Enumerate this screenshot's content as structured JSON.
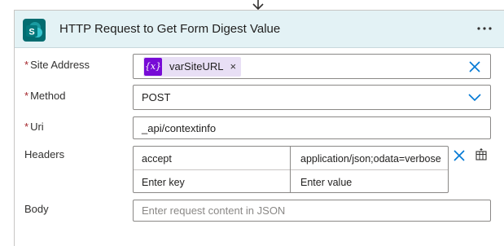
{
  "action": {
    "title": "HTTP Request to Get Form Digest Value",
    "more_icon": "more-options-icon",
    "connector_icon": "sharepoint-icon",
    "connector_color": "#036c70",
    "header_color": "#e3f2f5"
  },
  "fields": {
    "site_address": {
      "label": "Site Address",
      "required_mark": "*",
      "token_label": "varSiteURL",
      "token_icon_text": "{x}",
      "token_remove": "×",
      "token_color": "#770bd6"
    },
    "method": {
      "label": "Method",
      "required_mark": "*",
      "value": "POST"
    },
    "uri": {
      "label": "Uri",
      "required_mark": "*",
      "value": "_api/contextinfo"
    },
    "headers": {
      "label": "Headers",
      "rows": [
        {
          "key": "accept",
          "value": "application/json;odata=verbose"
        }
      ],
      "key_placeholder": "Enter key",
      "value_placeholder": "Enter value"
    },
    "body": {
      "label": "Body",
      "placeholder": "Enter request content in JSON"
    }
  },
  "accent_color": "#0078d4",
  "required_color": "#a4262c"
}
